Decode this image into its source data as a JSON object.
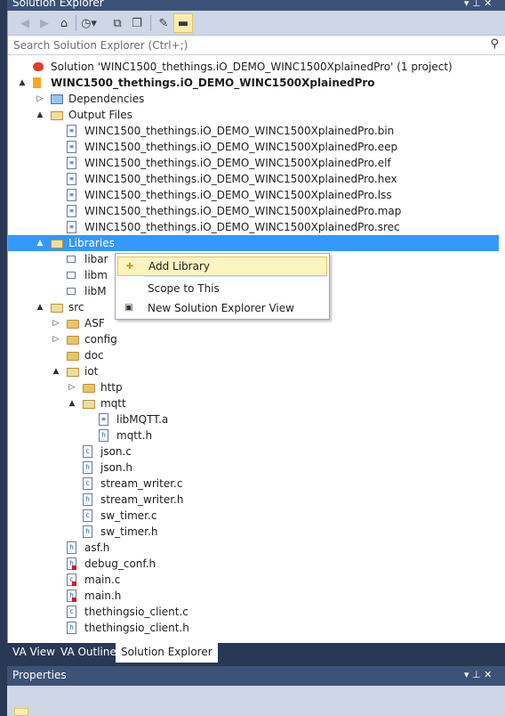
{
  "window": {
    "title": "Solution Explorer",
    "pin_glyph": "▾  ⊥  ✕"
  },
  "toolbar": {
    "buttons": [
      {
        "name": "back-icon",
        "glyph": "◀",
        "enabled": false
      },
      {
        "name": "forward-icon",
        "glyph": "▶",
        "enabled": false
      },
      {
        "name": "home-icon",
        "glyph": "⌂",
        "enabled": true
      },
      {
        "name": "history-icon",
        "glyph": "◷▾",
        "enabled": true
      },
      {
        "name": "collapse-all-icon",
        "glyph": "⧉",
        "enabled": true
      },
      {
        "name": "show-all-files-icon",
        "glyph": "❐",
        "enabled": true
      },
      {
        "name": "properties-wrench-icon",
        "glyph": "✎",
        "enabled": true
      },
      {
        "name": "preview-icon",
        "glyph": "▬",
        "enabled": true,
        "active": true
      }
    ]
  },
  "search": {
    "placeholder": "Search Solution Explorer (Ctrl+;)",
    "icon": "search-icon"
  },
  "tree": [
    {
      "label": "Solution 'WINC1500_thethings.iO_DEMO_WINC1500XplainedPro' (1 project)",
      "type": "solution",
      "level": 0,
      "arrow": ""
    },
    {
      "label": "WINC1500_thethings.iO_DEMO_WINC1500XplainedPro",
      "type": "project",
      "level": 0,
      "arrow": "▲",
      "bold": true
    },
    {
      "label": "Dependencies",
      "type": "deps",
      "level": 1,
      "arrow": "▷"
    },
    {
      "label": "Output Files",
      "type": "folder-open",
      "level": 1,
      "arrow": "▲"
    },
    {
      "label": "WINC1500_thethings.iO_DEMO_WINC1500XplainedPro.bin",
      "type": "file",
      "level": 2,
      "arrow": ""
    },
    {
      "label": "WINC1500_thethings.iO_DEMO_WINC1500XplainedPro.eep",
      "type": "file",
      "level": 2,
      "arrow": ""
    },
    {
      "label": "WINC1500_thethings.iO_DEMO_WINC1500XplainedPro.elf",
      "type": "file",
      "level": 2,
      "arrow": ""
    },
    {
      "label": "WINC1500_thethings.iO_DEMO_WINC1500XplainedPro.hex",
      "type": "file",
      "level": 2,
      "arrow": ""
    },
    {
      "label": "WINC1500_thethings.iO_DEMO_WINC1500XplainedPro.lss",
      "type": "file",
      "level": 2,
      "arrow": ""
    },
    {
      "label": "WINC1500_thethings.iO_DEMO_WINC1500XplainedPro.map",
      "type": "file",
      "level": 2,
      "arrow": ""
    },
    {
      "label": "WINC1500_thethings.iO_DEMO_WINC1500XplainedPro.srec",
      "type": "file",
      "level": 2,
      "arrow": ""
    },
    {
      "label": "Libraries",
      "type": "folder-open",
      "level": 1,
      "arrow": "▲",
      "selected": true
    },
    {
      "label": "libar",
      "type": "ref",
      "level": 2,
      "arrow": ""
    },
    {
      "label": "libm",
      "type": "ref",
      "level": 2,
      "arrow": ""
    },
    {
      "label": "libM",
      "type": "ref",
      "level": 2,
      "arrow": ""
    },
    {
      "label": "src",
      "type": "folder-open",
      "level": 1,
      "arrow": "▲"
    },
    {
      "label": "ASF",
      "type": "folder",
      "level": 2,
      "arrow": "▷"
    },
    {
      "label": "config",
      "type": "folder",
      "level": 2,
      "arrow": "▷"
    },
    {
      "label": "doc",
      "type": "folder",
      "level": 2,
      "arrow": ""
    },
    {
      "label": "iot",
      "type": "folder-open",
      "level": 2,
      "arrow": "▲"
    },
    {
      "label": "http",
      "type": "folder",
      "level": 3,
      "arrow": "▷"
    },
    {
      "label": "mqtt",
      "type": "folder-open",
      "level": 3,
      "arrow": "▲"
    },
    {
      "label": "libMQTT.a",
      "type": "file",
      "level": 4,
      "arrow": ""
    },
    {
      "label": "mqtt.h",
      "type": "hfile",
      "level": 4,
      "arrow": ""
    },
    {
      "label": "json.c",
      "type": "cfile",
      "level": 3,
      "arrow": ""
    },
    {
      "label": "json.h",
      "type": "hfile",
      "level": 3,
      "arrow": ""
    },
    {
      "label": "stream_writer.c",
      "type": "cfile",
      "level": 3,
      "arrow": ""
    },
    {
      "label": "stream_writer.h",
      "type": "hfile",
      "level": 3,
      "arrow": ""
    },
    {
      "label": "sw_timer.c",
      "type": "cfile",
      "level": 3,
      "arrow": ""
    },
    {
      "label": "sw_timer.h",
      "type": "hfile",
      "level": 3,
      "arrow": ""
    },
    {
      "label": "asf.h",
      "type": "hfile",
      "level": 2,
      "arrow": ""
    },
    {
      "label": "debug_conf.h",
      "type": "hfile-red",
      "level": 2,
      "arrow": ""
    },
    {
      "label": "main.c",
      "type": "cfile-red",
      "level": 2,
      "arrow": ""
    },
    {
      "label": "main.h",
      "type": "hfile-red",
      "level": 2,
      "arrow": ""
    },
    {
      "label": "thethingsio_client.c",
      "type": "cfile",
      "level": 2,
      "arrow": ""
    },
    {
      "label": "thethingsio_client.h",
      "type": "hfile",
      "level": 2,
      "arrow": ""
    }
  ],
  "context_menu": {
    "items": [
      {
        "label": "Add Library",
        "icon": "add-library-icon",
        "glyph": "✚",
        "hover": true
      },
      {
        "label": "Scope to This",
        "icon": "",
        "glyph": ""
      },
      {
        "label": "New Solution Explorer View",
        "icon": "new-view-icon",
        "glyph": "▣"
      }
    ]
  },
  "bottom_tabs": [
    {
      "label": "VA View",
      "active": false
    },
    {
      "label": "VA Outline",
      "active": false
    },
    {
      "label": "Solution Explorer",
      "active": true
    }
  ],
  "properties": {
    "title": "Properties",
    "pin_glyph": "▾  ⊥  ✕"
  }
}
